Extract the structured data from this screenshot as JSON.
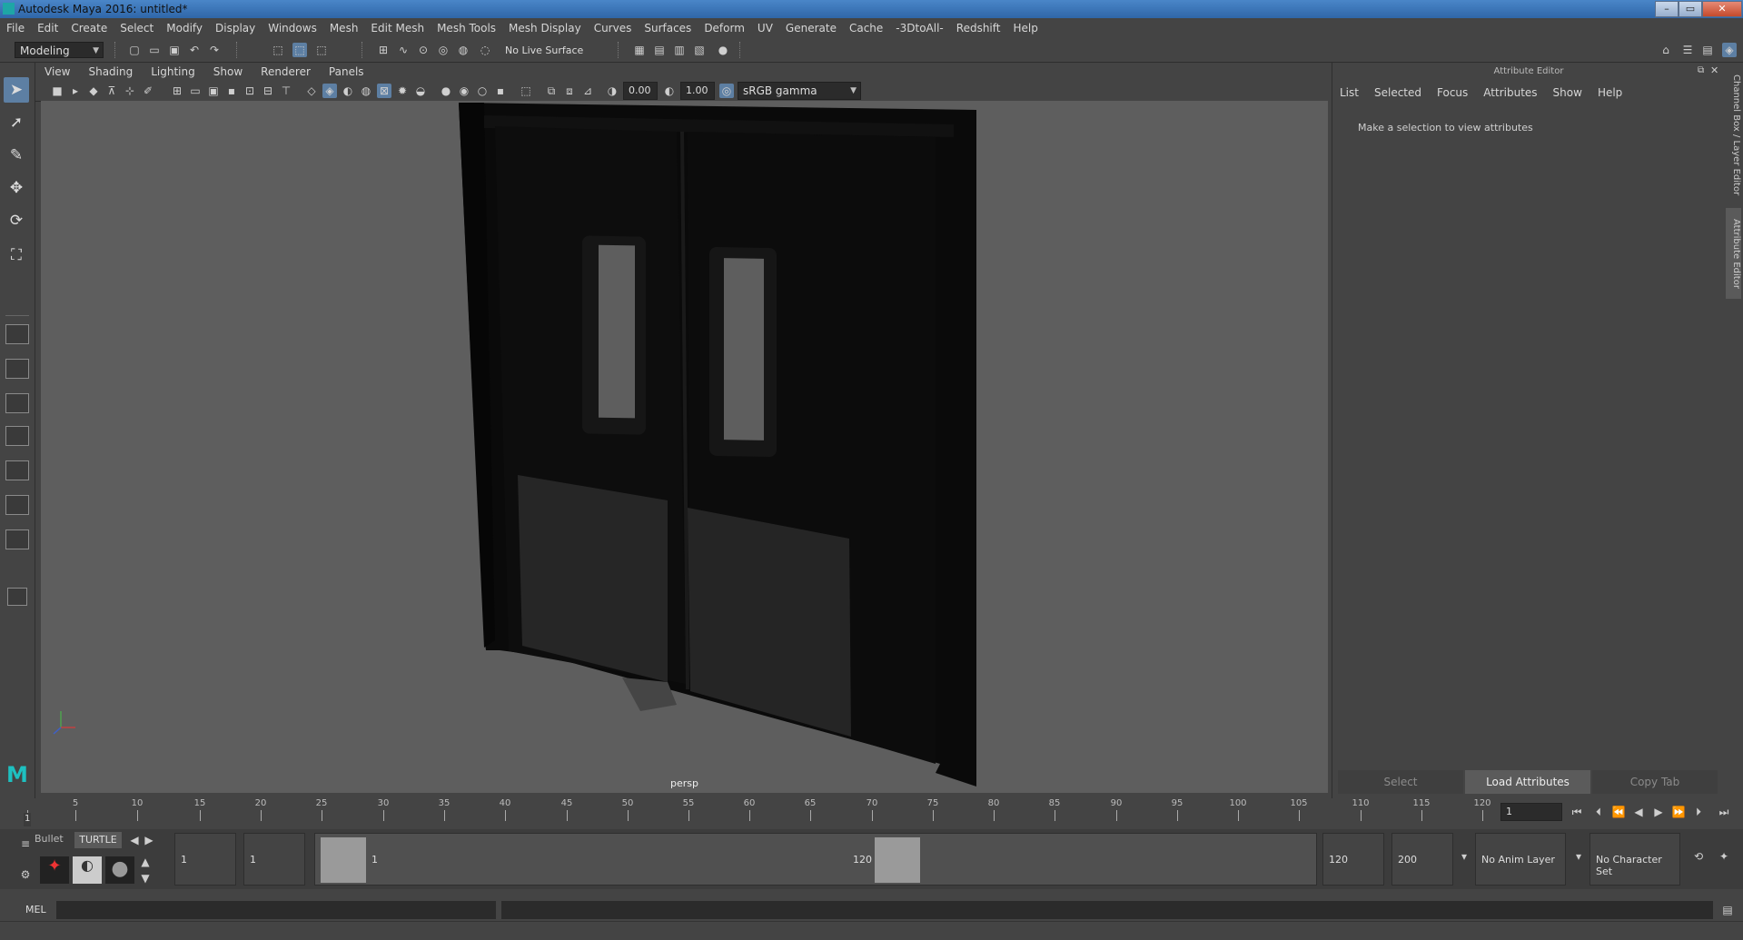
{
  "window": {
    "title": "Autodesk Maya 2016: untitled*"
  },
  "menubar": {
    "items": [
      "File",
      "Edit",
      "Create",
      "Select",
      "Modify",
      "Display",
      "Windows",
      "Mesh",
      "Edit Mesh",
      "Mesh Tools",
      "Mesh Display",
      "Curves",
      "Surfaces",
      "Deform",
      "UV",
      "Generate",
      "Cache",
      "-3DtoAll-",
      "Redshift",
      "Help"
    ]
  },
  "statusline": {
    "mode": "Modeling",
    "live_surface": "No Live Surface"
  },
  "viewport": {
    "menu": [
      "View",
      "Shading",
      "Lighting",
      "Show",
      "Renderer",
      "Panels"
    ],
    "exposure": "0.00",
    "gamma": "1.00",
    "color_space": "sRGB gamma",
    "camera": "persp"
  },
  "attribute_editor": {
    "title": "Attribute Editor",
    "tabs": [
      "List",
      "Selected",
      "Focus",
      "Attributes",
      "Show",
      "Help"
    ],
    "message": "Make a selection to view attributes",
    "buttons": {
      "select": "Select",
      "load": "Load Attributes",
      "copy": "Copy Tab"
    }
  },
  "side_tabs": {
    "channel_box": "Channel Box / Layer Editor",
    "attribute_editor": "Attribute Editor"
  },
  "timeline": {
    "ticks": [
      "1",
      "5",
      "10",
      "15",
      "20",
      "25",
      "30",
      "35",
      "40",
      "45",
      "50",
      "55",
      "60",
      "65",
      "70",
      "75",
      "80",
      "85",
      "90",
      "95",
      "100",
      "105",
      "110",
      "115",
      "120"
    ],
    "current_frame": "1",
    "current_marker": "1"
  },
  "range": {
    "shelf_tabs": {
      "bullet": "Bullet",
      "turtle": "TURTLE"
    },
    "start": "1",
    "playback_start": "1",
    "slider_start": "1",
    "slider_end": "120",
    "playback_end": "120",
    "end": "200",
    "anim_layer": "No Anim Layer",
    "character_set": "No Character Set"
  },
  "command": {
    "label": "MEL"
  },
  "colors": {
    "ui_bg": "#444444",
    "viewport_bg": "#5e5e5e",
    "highlight": "#5d7fa3"
  }
}
